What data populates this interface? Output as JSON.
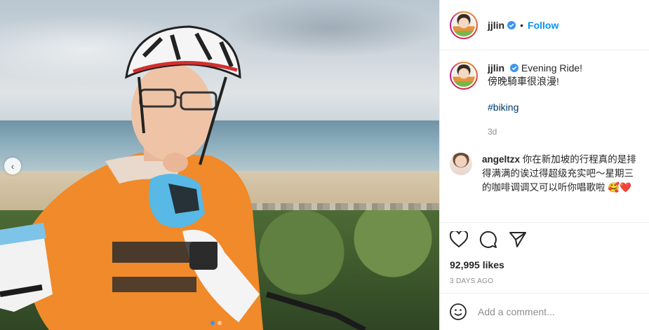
{
  "post": {
    "author": "jjlin",
    "follow_label": "Follow",
    "separator": "•",
    "caption_line1": "Evening Ride!",
    "caption_line2": "傍晚騎車很浪漫!",
    "hashtag": "#biking",
    "posted_relative": "3d",
    "likes": "92,995 likes",
    "posted_ago": "3 DAYS AGO",
    "add_comment_placeholder": "Add a comment...",
    "carousel_prev": "‹",
    "carousel_dots": 2,
    "carousel_active_index": 0
  },
  "comments": [
    {
      "username": "angeltzx",
      "text": "你在新加坡的行程真的是排得满满的诶过得超级充实吧～星期三的咖啡调调又可以听你唱歌啦",
      "emojis": "🥰❤️"
    }
  ],
  "icons": {
    "like": "heart-icon",
    "comment": "comment-icon",
    "share": "share-icon",
    "emoji": "emoji-icon",
    "verified": "verified-badge-icon"
  },
  "colors": {
    "link_blue": "#0095f6",
    "hashtag": "#00376b",
    "muted": "#8e8e8e",
    "verified": "#3897f0"
  }
}
